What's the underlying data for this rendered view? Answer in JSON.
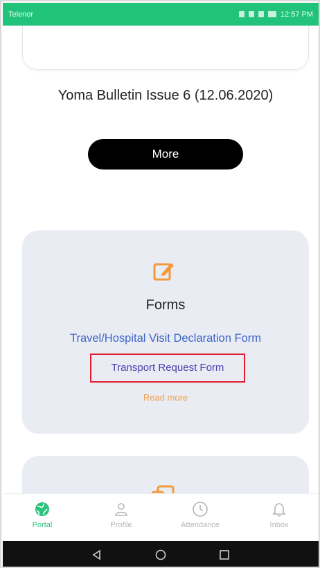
{
  "status_bar": {
    "carrier": "Telenor",
    "time": "12:57 PM"
  },
  "bulletin": {
    "title": "Yoma Bulletin Issue 6 (12.06.2020)",
    "more_label": "More"
  },
  "forms_card": {
    "title": "Forms",
    "links": {
      "travel": "Travel/Hospital Visit Declaration Form",
      "transport": "Transport Request Form"
    },
    "read_more": "Read more"
  },
  "bottom_nav": {
    "items": [
      {
        "label": "Portal",
        "icon": "globe-icon",
        "active": true
      },
      {
        "label": "Profile",
        "icon": "user-icon",
        "active": false
      },
      {
        "label": "Attendance",
        "icon": "clock-icon",
        "active": false
      },
      {
        "label": "Inbox",
        "icon": "bell-icon",
        "active": false
      }
    ]
  },
  "colors": {
    "status_bar": "#21c279",
    "accent": "#2ec27e",
    "link": "#3d64c8",
    "highlight_border": "#e31e2c",
    "read_more": "#f0a050",
    "card_bg": "#e9ecf3",
    "icon_orange": "#f29a3a"
  }
}
